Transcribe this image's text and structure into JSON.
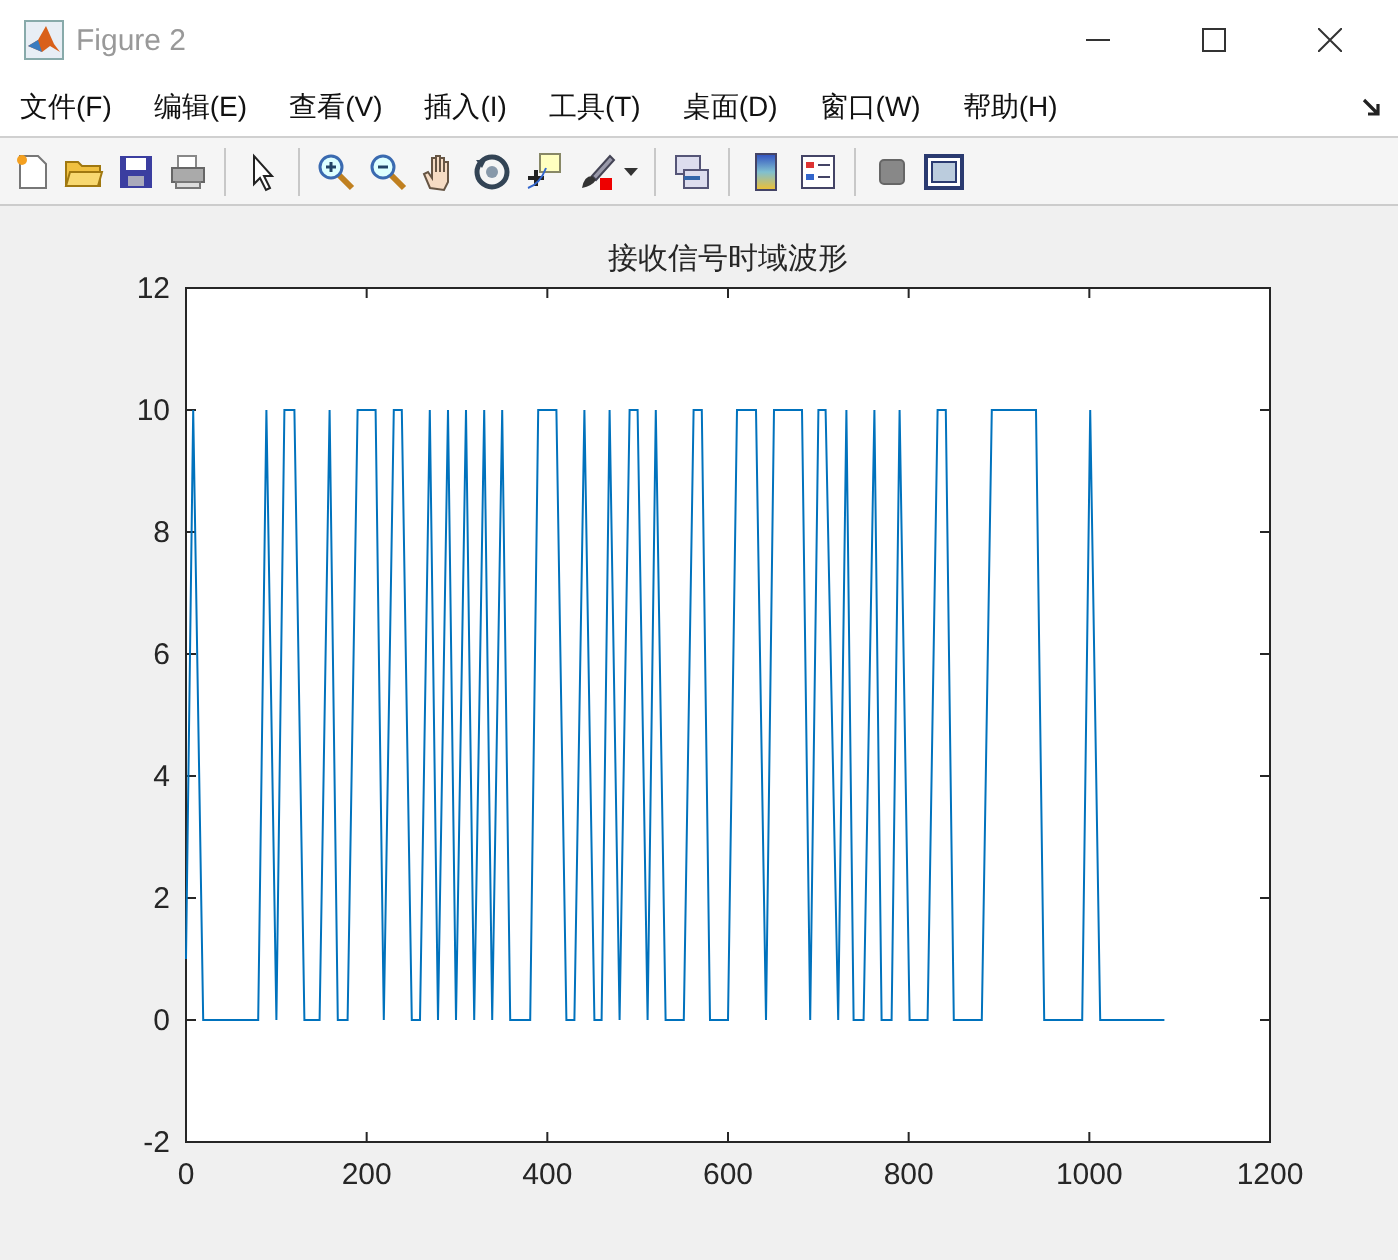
{
  "window": {
    "title": "Figure 2"
  },
  "menu": [
    "文件(F)",
    "编辑(E)",
    "查看(V)",
    "插入(I)",
    "工具(T)",
    "桌面(D)",
    "窗口(W)",
    "帮助(H)"
  ],
  "figure": {
    "chart_data": {
      "type": "line",
      "title": "接收信号时域波形",
      "xlim": [
        0,
        1200
      ],
      "ylim": [
        -2,
        12
      ],
      "xticks": [
        0,
        200,
        400,
        600,
        800,
        1000,
        1200
      ],
      "yticks": [
        -2,
        0,
        2,
        4,
        6,
        8,
        10,
        12
      ],
      "x": [
        0,
        8,
        19,
        80,
        89,
        100,
        109,
        120,
        131,
        148,
        159,
        168,
        179,
        190,
        210,
        219,
        230,
        239,
        250,
        259,
        270,
        279,
        290,
        299,
        310,
        319,
        330,
        339,
        350,
        359,
        381,
        390,
        410,
        421,
        430,
        441,
        452,
        460,
        469,
        480,
        491,
        500,
        511,
        520,
        531,
        551,
        562,
        571,
        580,
        600,
        610,
        631,
        642,
        651,
        682,
        691,
        700,
        708,
        722,
        731,
        739,
        750,
        762,
        770,
        781,
        790,
        801,
        821,
        832,
        841,
        850,
        881,
        892,
        941,
        950,
        992,
        1001,
        1012,
        1083
      ],
      "series": [
        {
          "color": "#0072bd",
          "values": [
            1,
            10,
            0,
            0,
            10,
            0,
            10,
            10,
            0,
            0,
            10,
            0,
            0,
            10,
            10,
            0,
            10,
            10,
            0,
            0,
            10,
            0,
            10,
            0,
            10,
            0,
            10,
            0,
            10,
            0,
            0,
            10,
            10,
            0,
            0,
            10,
            0,
            0,
            10,
            0,
            10,
            10,
            0,
            10,
            0,
            0,
            10,
            10,
            0,
            0,
            10,
            10,
            0,
            10,
            10,
            0,
            10,
            10,
            0,
            10,
            0,
            0,
            10,
            0,
            0,
            10,
            0,
            0,
            10,
            10,
            0,
            0,
            10,
            10,
            0,
            0,
            10,
            0,
            0
          ]
        }
      ]
    }
  }
}
